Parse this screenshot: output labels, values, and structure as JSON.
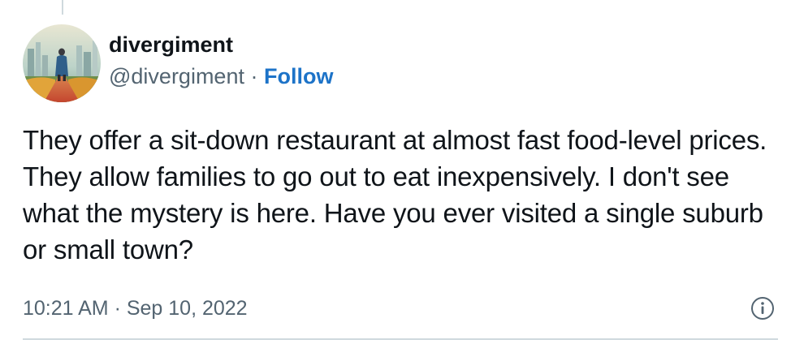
{
  "user": {
    "display_name": "divergiment",
    "handle": "@divergiment",
    "separator": " · ",
    "follow_label": "Follow"
  },
  "tweet": {
    "text": "They offer a sit-down restaurant at almost fast food-level prices. They allow families to go out to eat inexpensively. I don't see what the mystery is here. Have you ever visited a single suburb or small town?",
    "timestamp": "10:21 AM · Sep 10, 2022"
  },
  "icons": {
    "info": "info-icon",
    "avatar": "avatar"
  },
  "colors": {
    "follow": "#1d73c8",
    "secondary_text": "#536471",
    "divider": "#cfd9de"
  }
}
